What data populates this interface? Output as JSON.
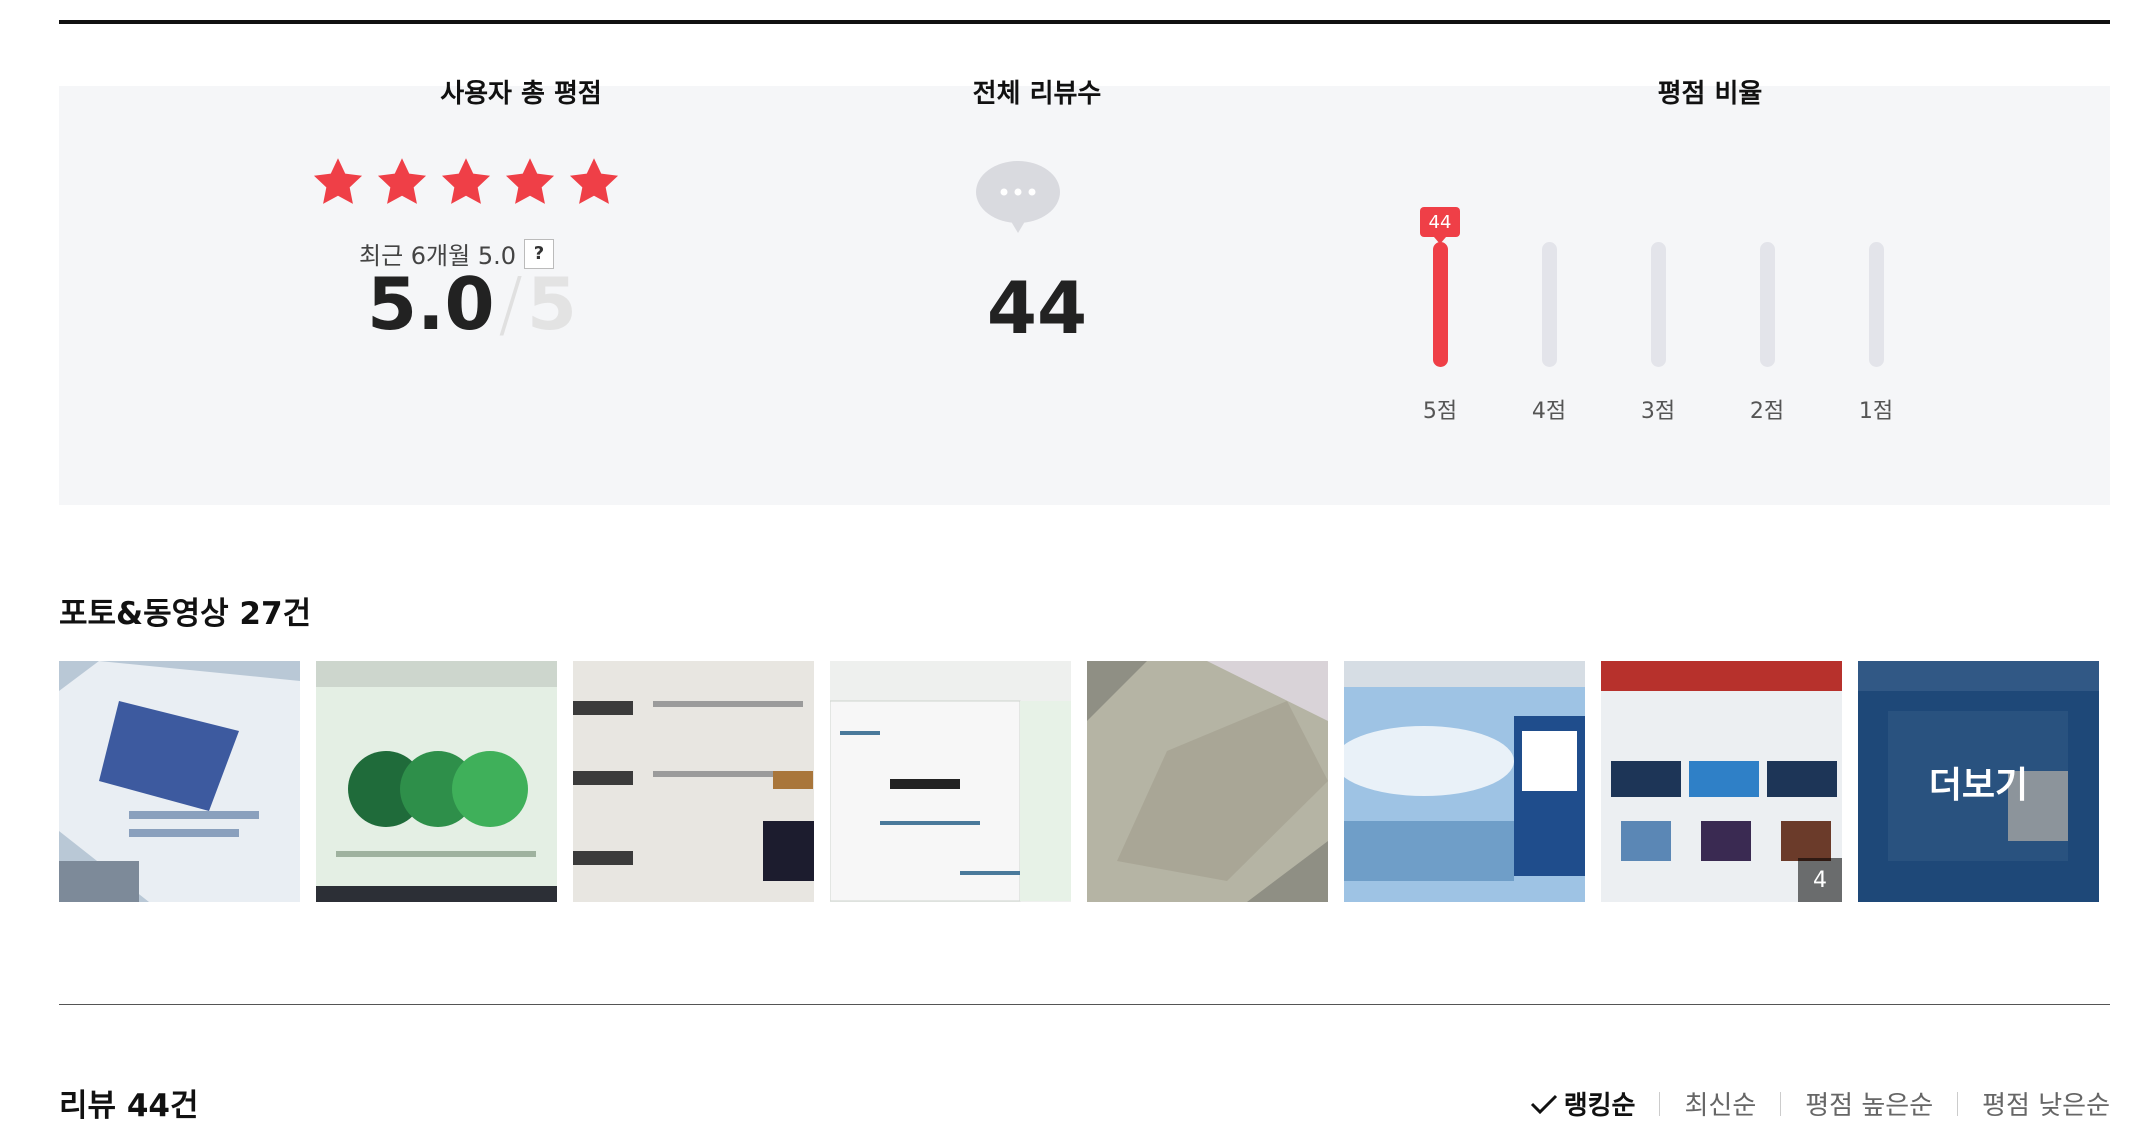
{
  "summary": {
    "rating_title": "사용자 총 평점",
    "stars": 5,
    "recent_text": "최근 6개월 5.0",
    "help_label": "?",
    "score": "5.0",
    "score_sep": "/",
    "score_max": "5",
    "review_count_title": "전체 리뷰수",
    "review_count": "44",
    "ratio_title": "평점 비율",
    "distribution": [
      {
        "label": "5점",
        "count": 44,
        "fraction": 1.0,
        "badge": "44"
      },
      {
        "label": "4점",
        "count": 0,
        "fraction": 0
      },
      {
        "label": "3점",
        "count": 0,
        "fraction": 0
      },
      {
        "label": "2점",
        "count": 0,
        "fraction": 0
      },
      {
        "label": "1점",
        "count": 0,
        "fraction": 0
      }
    ],
    "colors": {
      "accent": "#ef3f47",
      "track": "#e3e4ea",
      "panel": "#f5f6f8"
    }
  },
  "photos": {
    "title": "포토&동영상 27건",
    "thumb_extra_count": "4",
    "more_label": "더보기"
  },
  "reviews": {
    "title": "리뷰 44건",
    "sort_options": [
      "랭킹순",
      "최신순",
      "평점 높은순",
      "평점 낮은순"
    ],
    "active_sort": "랭킹순"
  }
}
